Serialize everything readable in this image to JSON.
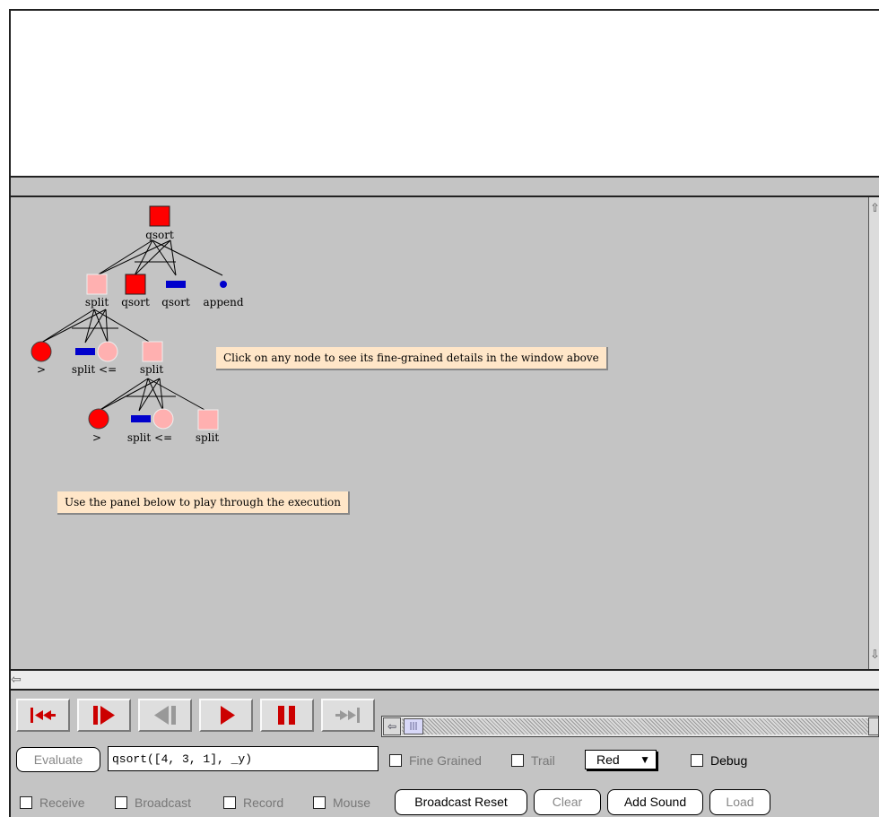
{
  "tree": {
    "root": {
      "label": "qsort",
      "color": "#ff0000"
    },
    "level1": [
      {
        "label": "split",
        "color": "#ffb0b0"
      },
      {
        "label": "qsort",
        "color": "#ff0000"
      },
      {
        "label": "qsort",
        "color": "#0000cc"
      },
      {
        "label": "append",
        "color": "#0000cc"
      }
    ],
    "level2": [
      {
        "label": ">",
        "color": "#ff0000"
      },
      {
        "label": "split <=",
        "color": "#ffb0b0"
      },
      {
        "label": "split",
        "color": "#ffb0b0"
      }
    ],
    "level3": [
      {
        "label": ">",
        "color": "#ff0000"
      },
      {
        "label": "split <=",
        "color": "#ffb0b0"
      },
      {
        "label": "split",
        "color": "#ffb0b0"
      }
    ]
  },
  "callouts": {
    "node_hint": "Click on any node to see its fine-grained details in the window above",
    "panel_hint": "Use the panel below to play through the execution"
  },
  "playback": {
    "buttons": [
      {
        "name": "rewind-button",
        "icon": "rewind-to-start-icon",
        "enabled": true
      },
      {
        "name": "step-forward-button",
        "icon": "step-forward-icon",
        "enabled": true
      },
      {
        "name": "step-back-button",
        "icon": "step-back-icon",
        "enabled": false
      },
      {
        "name": "play-button",
        "icon": "play-icon",
        "enabled": true
      },
      {
        "name": "pause-button",
        "icon": "pause-icon",
        "enabled": true
      },
      {
        "name": "fast-forward-button",
        "icon": "fast-forward-to-end-icon",
        "enabled": false
      }
    ],
    "accent": "#cc0000",
    "disabled_color": "#999999"
  },
  "controls": {
    "evaluate_label": "Evaluate",
    "query": "qsort([4, 3, 1], _y)",
    "fine_grained_label": "Fine Grained",
    "trail_label": "Trail",
    "color_value": "Red",
    "debug_label": "Debug",
    "receive_label": "Receive",
    "broadcast_label": "Broadcast",
    "record_label": "Record",
    "mouse_label": "Mouse",
    "broadcast_reset_label": "Broadcast Reset",
    "clear_label": "Clear",
    "add_sound_label": "Add Sound",
    "load_label": "Load"
  }
}
